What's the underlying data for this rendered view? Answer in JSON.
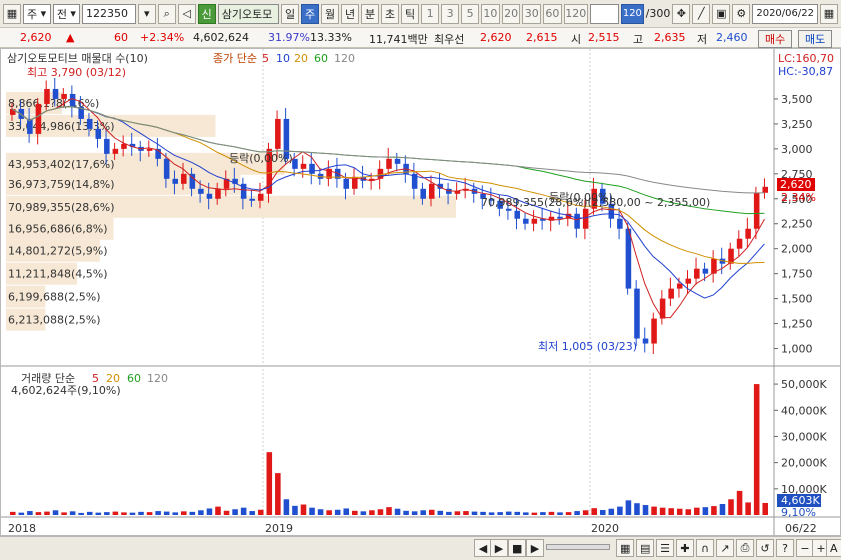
{
  "toolbar": {
    "mode_label": "주",
    "market_label": "전",
    "code_value": "122350",
    "badge": "신",
    "stock_name": "삼기오토모",
    "periods": [
      "일",
      "주",
      "월",
      "년",
      "분",
      "초",
      "틱"
    ],
    "active_period": "주",
    "intervals": [
      "1",
      "3",
      "5",
      "10",
      "20",
      "30",
      "60",
      "120"
    ],
    "count_value": "120",
    "count_total": "/300",
    "date_value": "2020/06/22"
  },
  "quote": {
    "price": "2,620",
    "change": "60",
    "change_pct": "+2.34%",
    "volume": "4,602,624",
    "turnover_pct": "31.97%",
    "ratio_pct": "13.33%",
    "amount": "11,741백만",
    "best_ask_label": "최우선",
    "best_ask": "2,620",
    "best_bid": "2,615",
    "open_label": "시",
    "open": "2,515",
    "high_label": "고",
    "high": "2,635",
    "low_label": "저",
    "low": "2,460",
    "buy_label": "매수",
    "sell_label": "매도"
  },
  "chart_data": {
    "type": "candlestick",
    "title": "삼기오토모티브 매물대 수(10)",
    "price_legend": {
      "label": "종가 단순",
      "periods": [
        "5",
        "10",
        "20",
        "60",
        "120"
      ]
    },
    "lc": "LC:160,70",
    "hc": "HC:-30,87",
    "y_ticks": [
      "3,500",
      "3,250",
      "3,000",
      "2,750",
      "2,500",
      "2,250",
      "2,000",
      "1,750",
      "1,500",
      "1,250",
      "1,000"
    ],
    "ylim": [
      875,
      3800
    ],
    "x_labels": [
      "2018",
      "2019",
      "2020",
      "06/22"
    ],
    "current_price": "2,620",
    "current_pct": "2.34%",
    "annotations": {
      "high": "최고 3,790 (03/12)",
      "low": "최저 1,005 (03/23)",
      "high_ratio": "33,044,986(13,3%)",
      "range_text": "70,989,355(28,6%)(2,580,00 ~ 2,355,00)",
      "drop1": "등락(0,00%)",
      "drop2": "등락(0,00%)"
    },
    "volume_profile": [
      {
        "label": "8,866,1?8(3,6%)",
        "price": 3460,
        "value": 8866
      },
      {
        "label": "33,044,986(13,3%)",
        "price": 3230,
        "value": 33045
      },
      {
        "label": "43,953,402(17,6%)",
        "price": 2850,
        "value": 43953
      },
      {
        "label": "36,973,759(14,8%)",
        "price": 2650,
        "value": 36974
      },
      {
        "label": "70,989,355(28,6%)",
        "price": 2420,
        "value": 70989
      },
      {
        "label": "16,956,686(6,8%)",
        "price": 2200,
        "value": 16957
      },
      {
        "label": "14,801,272(5,9%)",
        "price": 1980,
        "value": 14801
      },
      {
        "label": "11,211,848(4,5%)",
        "price": 1750,
        "value": 11212
      },
      {
        "label": "6,199,688(2,5%)",
        "price": 1520,
        "value": 6200
      },
      {
        "label": "6,213,088(2,5%)",
        "price": 1290,
        "value": 6213
      }
    ],
    "closes": [
      3400,
      3300,
      3150,
      3450,
      3600,
      3500,
      3550,
      3420,
      3300,
      3200,
      3100,
      2950,
      3000,
      3050,
      3020,
      2980,
      3000,
      2900,
      2700,
      2650,
      2750,
      2600,
      2550,
      2500,
      2600,
      2700,
      2650,
      2500,
      2480,
      2550,
      3000,
      3300,
      2900,
      2800,
      2850,
      2750,
      2700,
      2800,
      2700,
      2600,
      2720,
      2680,
      2700,
      2800,
      2900,
      2850,
      2750,
      2600,
      2500,
      2650,
      2600,
      2550,
      2580,
      2600,
      2550,
      2500,
      2480,
      2400,
      2380,
      2300,
      2250,
      2300,
      2280,
      2320,
      2300,
      2350,
      2200,
      2400,
      2600,
      2450,
      2300,
      2200,
      1600,
      1100,
      1050,
      1300,
      1500,
      1600,
      1650,
      1700,
      1800,
      1750,
      1900,
      1850,
      2000,
      2100,
      2200,
      2560,
      2620
    ],
    "volume_panel": {
      "title": "거래량 단순",
      "periods": [
        "5",
        "20",
        "60",
        "120"
      ],
      "current": "4,602,624주(9,10%)",
      "y_ticks": [
        "50,000K",
        "40,000K",
        "30,000K",
        "20,000K",
        "10,000K"
      ],
      "badge_value": "4,603K",
      "badge_pct": "9,10%",
      "ylim": [
        0,
        55000
      ],
      "volumes": [
        1200,
        900,
        1500,
        1100,
        1300,
        1800,
        1000,
        1400,
        800,
        1200,
        900,
        1100,
        1300,
        1000,
        900,
        1200,
        1100,
        1500,
        1300,
        1000,
        1400,
        1200,
        1800,
        2500,
        3200,
        1600,
        2200,
        2800,
        1500,
        2000,
        24000,
        16000,
        6000,
        3500,
        4000,
        2800,
        2200,
        1800,
        2000,
        2500,
        1600,
        1400,
        1800,
        2200,
        3000,
        2400,
        1600,
        1400,
        1800,
        2000,
        1600,
        1200,
        1400,
        1500,
        1300,
        1200,
        1000,
        1100,
        1300,
        1200,
        1000,
        900,
        1100,
        1200,
        1000,
        1100,
        1500,
        1800,
        2600,
        1900,
        2400,
        3200,
        5600,
        4500,
        3800,
        3200,
        2800,
        2600,
        2400,
        2200,
        2800,
        3000,
        3400,
        4200,
        6000,
        9200,
        4800,
        50000,
        4603
      ]
    }
  },
  "bottom_bar": {
    "buttons": [
      "◀",
      "▶",
      "■",
      "▶"
    ],
    "right_buttons": [
      "−",
      "+",
      "A"
    ]
  }
}
